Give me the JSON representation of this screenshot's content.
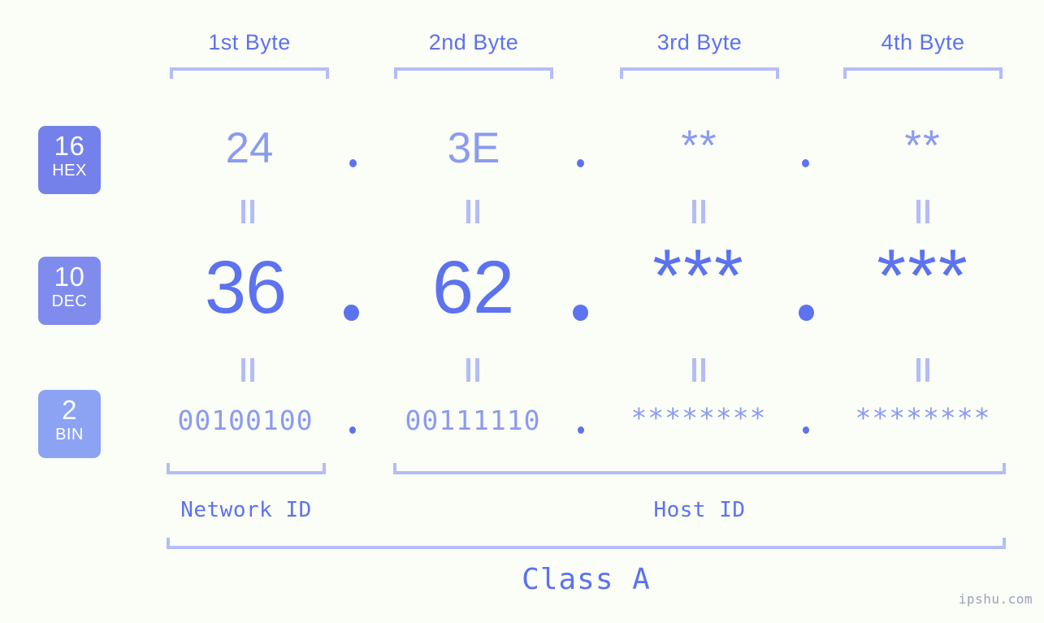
{
  "background_color": "#fbfdf7",
  "accent_color": "#5c72ef",
  "accent_light_color": "#8a9bf0",
  "accent_pale_color": "#b3bdf7",
  "byte_headers": [
    {
      "label": "1st Byte"
    },
    {
      "label": "2nd Byte"
    },
    {
      "label": "3rd Byte"
    },
    {
      "label": "4th Byte"
    }
  ],
  "bases": [
    {
      "number": "16",
      "name": "HEX",
      "color": "#7581ea"
    },
    {
      "number": "10",
      "name": "DEC",
      "color": "#7f8cee"
    },
    {
      "number": "2",
      "name": "BIN",
      "color": "#8ca3f4"
    }
  ],
  "rows": {
    "hex": {
      "base_number": "16",
      "base_name": "HEX",
      "values": [
        "24",
        "3E",
        "**",
        "**"
      ],
      "separator": "."
    },
    "dec": {
      "base_number": "10",
      "base_name": "DEC",
      "values": [
        "36",
        "62",
        "***",
        "***"
      ],
      "separator": "."
    },
    "bin": {
      "base_number": "2",
      "base_name": "BIN",
      "values": [
        "00100100",
        "00111110",
        "********",
        "********"
      ],
      "separator": "."
    }
  },
  "equality_marks": {
    "symbol": "||",
    "count_per_gap": 4
  },
  "segments": [
    {
      "label": "Network ID"
    },
    {
      "label": "Host ID"
    }
  ],
  "address_class": {
    "label": "Class A"
  },
  "watermark": {
    "text": "ipshu.com"
  }
}
